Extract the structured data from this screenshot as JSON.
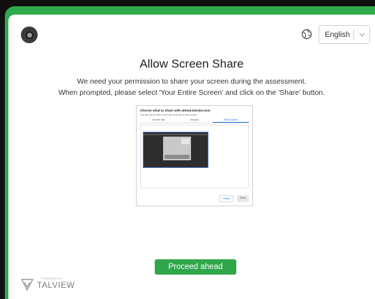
{
  "header": {
    "language": {
      "selected": "English"
    }
  },
  "main": {
    "title": "Allow Screen Share",
    "description_lines": [
      "We need your permission to share your screen during the assessment.",
      "When prompted, please select 'Your Entire Screen' and click on the 'Share' button."
    ],
    "illustration": {
      "dialog_title": "Choose what to share with attend.talview.com",
      "dialog_subtitle": "The site will be able to see the contents of your screen",
      "tabs": [
        "Chrome Tab",
        "Window",
        "Entire Screen"
      ],
      "active_tab_index": 2,
      "cancel_label": "Cancel",
      "share_label": "Share"
    },
    "proceed_label": "Proceed ahead"
  },
  "footer": {
    "powered_by": "POWERED BY",
    "brand": "TALVIEW"
  },
  "colors": {
    "accent_green": "#30a64a",
    "border_green": "#2faa4d",
    "link_blue": "#1a73e8"
  },
  "icons": {
    "top_left": "camera-icon",
    "globe": "globe-icon",
    "dropdown": "chevron-down-icon",
    "brand": "talview-logo-icon"
  }
}
